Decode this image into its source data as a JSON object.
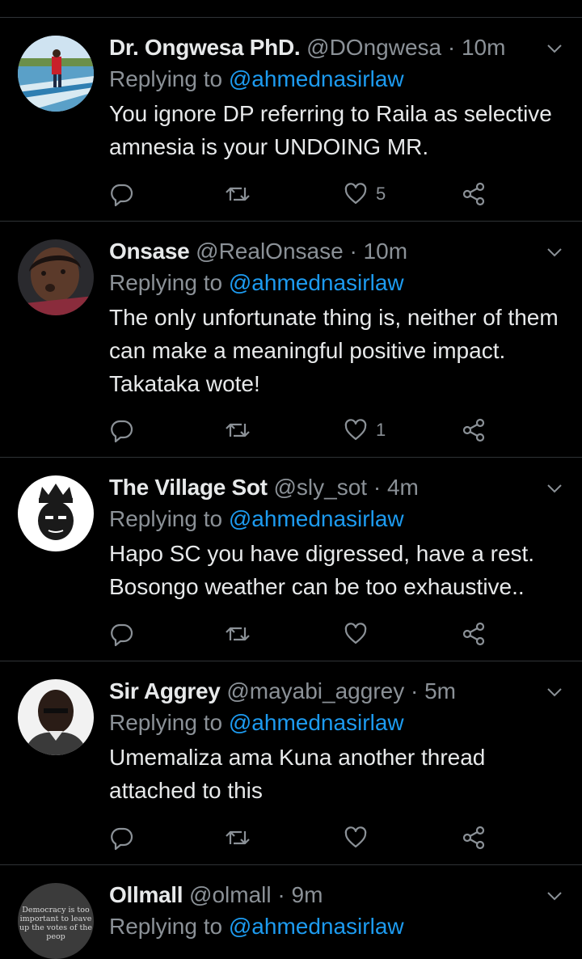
{
  "tweets": [
    {
      "name": "Dr. Ongwesa PhD.",
      "handle": "@DOngwesa",
      "time": "· 10m",
      "replying_prefix": "Replying to",
      "replying_to": "@ahmednasirlaw",
      "text": "You ignore DP referring to Raila as selective amnesia is your UNDOING MR.",
      "likes": "5"
    },
    {
      "name": "Onsase",
      "handle": "@RealOnsase",
      "time": "· 10m",
      "replying_prefix": "Replying to",
      "replying_to": "@ahmednasirlaw",
      "text": "The only unfortunate thing is, neither of them can make a meaningful positive impact. Takataka wote!",
      "likes": "1"
    },
    {
      "name": "The Village Sot",
      "handle": "@sly_sot",
      "time": "· 4m",
      "replying_prefix": "Replying to",
      "replying_to": "@ahmednasirlaw",
      "text": "Hapo SC you have digressed, have a rest. Bosongo weather can be too exhaustive..",
      "likes": ""
    },
    {
      "name": "Sir Aggrey",
      "handle": "@mayabi_aggrey",
      "time": "· 5m",
      "replying_prefix": "Replying to",
      "replying_to": "@ahmednasirlaw",
      "text": "Umemaliza ama Kuna another thread attached to this",
      "likes": ""
    },
    {
      "name": "Ollmall",
      "handle": "@olmall",
      "time": "· 9m",
      "replying_prefix": "Replying to",
      "replying_to": "@ahmednasirlaw",
      "avatar_text": "Democracy is too important to leave up the votes of the peop"
    }
  ],
  "colors": {
    "background": "#000000",
    "accent": "#1d9bf0",
    "muted": "#8b9197",
    "divider": "#2f3336"
  },
  "icons": [
    "chevron-down-icon",
    "reply-icon",
    "retweet-icon",
    "like-icon",
    "share-icon"
  ]
}
